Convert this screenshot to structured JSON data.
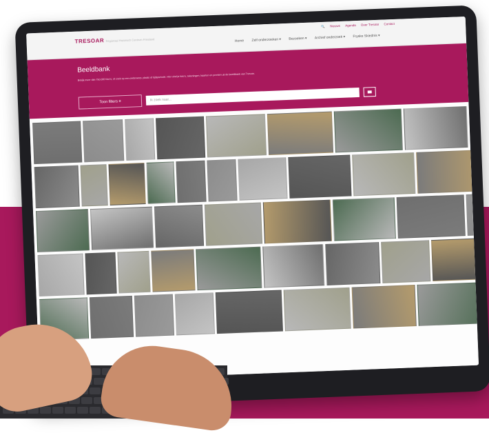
{
  "site": {
    "logo": "TRESOAR",
    "tagline": "Regionaal Historisch Centrum Friesland"
  },
  "top_links": [
    "Nieuws",
    "Agenda",
    "Over Tresoar",
    "Contact"
  ],
  "nav": [
    "Home",
    "Zelf onderzoeken ▾",
    "Bezoeken ▾",
    "Archief onderzoek ▾",
    "Fryske Skiednis ▾"
  ],
  "hero": {
    "title": "Beeldbank",
    "intro": "Bekijk meer dan 750.000 foto's, of zoek op een onderwerp, plaats of tijdsperiode. Hier vind je foto's, tekeningen, kaarten en prenten uit de beeldbank van Tresoar.",
    "filters_button": "Toon filters",
    "search_placeholder": "Ik zoek naar..."
  },
  "colors": {
    "brand": "#a8195c"
  },
  "photos": [
    "photo-1",
    "photo-2",
    "photo-3",
    "photo-4",
    "photo-5",
    "photo-6",
    "photo-7",
    "photo-8",
    "photo-9",
    "photo-10",
    "photo-11",
    "photo-12",
    "photo-13",
    "photo-14",
    "photo-15",
    "photo-16",
    "photo-17",
    "photo-18",
    "photo-19",
    "photo-20",
    "photo-21",
    "photo-22",
    "photo-23",
    "photo-24",
    "photo-25",
    "photo-26",
    "photo-27",
    "photo-28",
    "photo-29",
    "photo-30",
    "photo-31",
    "photo-32",
    "photo-33",
    "photo-34",
    "photo-35",
    "photo-36",
    "photo-37",
    "photo-38",
    "photo-39",
    "photo-40"
  ]
}
